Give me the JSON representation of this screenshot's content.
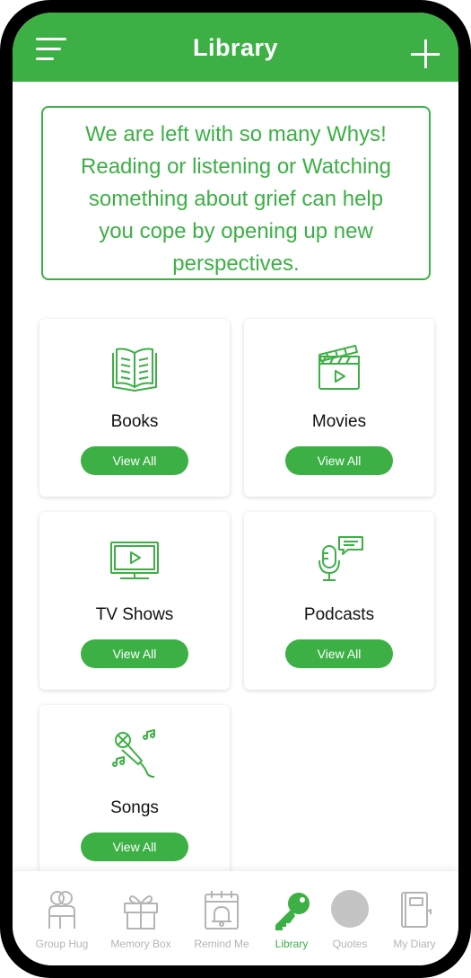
{
  "header": {
    "title": "Library"
  },
  "banner": {
    "lines": [
      "We are left with so many Whys!",
      "Reading or listening or Watching",
      "something about grief can help",
      "you cope by opening up new",
      "perspectives."
    ]
  },
  "categories": [
    {
      "title": "Books",
      "button": "View All",
      "icon": "open-book-icon"
    },
    {
      "title": "Movies",
      "button": "View All",
      "icon": "clapperboard-icon"
    },
    {
      "title": "TV Shows",
      "button": "View All",
      "icon": "tv-icon"
    },
    {
      "title": "Podcasts",
      "button": "View All",
      "icon": "microphone-chat-icon"
    },
    {
      "title": "Songs",
      "button": "View All",
      "icon": "karaoke-mic-icon"
    }
  ],
  "nav": [
    {
      "label": "Group Hug",
      "icon": "group-hug-icon",
      "active": false
    },
    {
      "label": "Memory Box",
      "icon": "gift-box-icon",
      "active": false
    },
    {
      "label": "Remind Me",
      "icon": "calendar-bell-icon",
      "active": false
    },
    {
      "label": "Library",
      "icon": "key-icon",
      "active": true
    },
    {
      "label": "Quotes",
      "icon": "quotes-circle-icon",
      "active": false
    },
    {
      "label": "My Diary",
      "icon": "diary-icon",
      "active": false
    }
  ],
  "colors": {
    "accent": "#3cb045",
    "inactive": "#b5b5b5",
    "frame": "#000000"
  }
}
